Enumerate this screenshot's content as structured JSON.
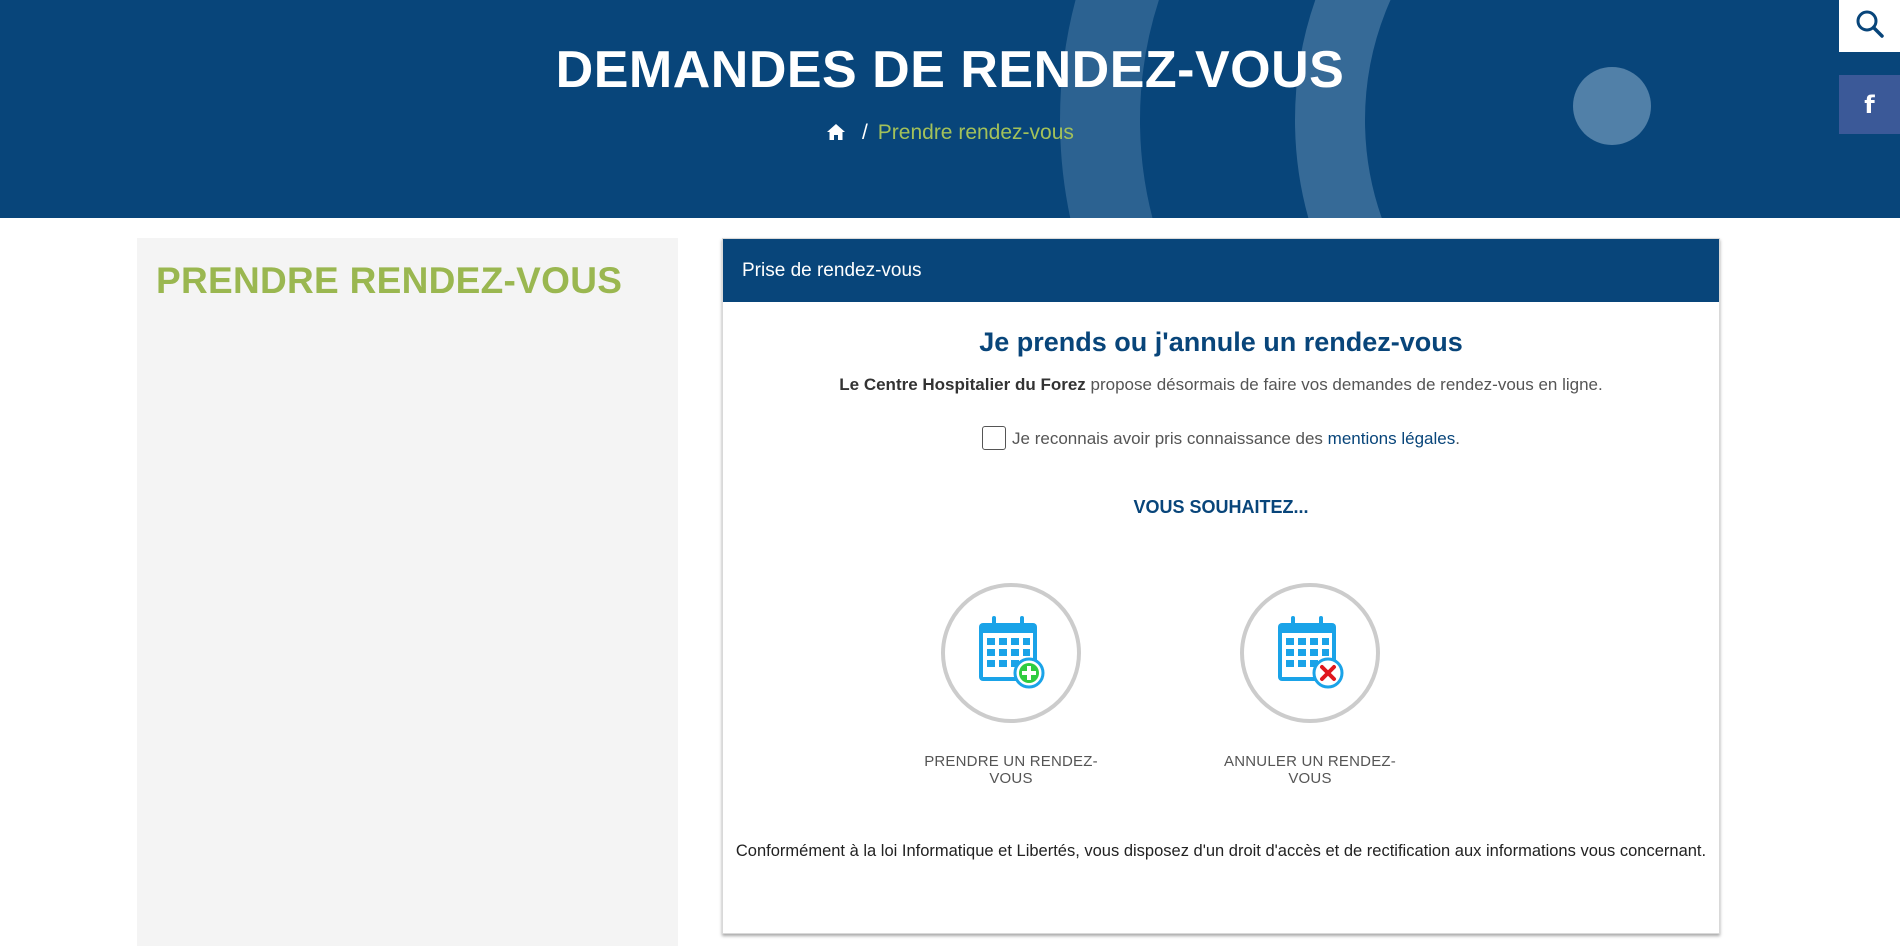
{
  "hero": {
    "title": "DEMANDES DE RENDEZ-VOUS",
    "breadcrumb": {
      "home_icon": "home-icon",
      "separator": "/",
      "current": "Prendre rendez-vous"
    }
  },
  "social": {
    "search_icon": "search-icon",
    "facebook_icon": "facebook-icon",
    "facebook_glyph": "f"
  },
  "sidebar": {
    "title": "PRENDRE RENDEZ-VOUS"
  },
  "card": {
    "header": "Prise de rendez-vous",
    "heading": "Je prends ou j'annule un rendez-vous",
    "intro_bold": "Le Centre Hospitalier du Forez",
    "intro_rest": " propose désormais de faire vos demandes de rendez-vous en ligne.",
    "consent_text": "Je reconnais avoir pris connaissance des ",
    "consent_link": "mentions légales",
    "consent_end": ".",
    "wish": "VOUS SOUHAITEZ...",
    "actions": [
      {
        "label": "PRENDRE UN RENDEZ-VOUS",
        "icon": "calendar-add-icon"
      },
      {
        "label": "ANNULER UN RENDEZ-VOUS",
        "icon": "calendar-cancel-icon"
      }
    ],
    "legal": "Conformément à la loi Informatique et Libertés, vous disposez d'un droit d'accès et de rectification aux informations vous concernant."
  },
  "colors": {
    "brand_blue": "#08457a",
    "accent_green": "#9ab750",
    "calendar_blue": "#1aa3e8",
    "add_green": "#2ecc40",
    "cancel_red": "#e0161d"
  }
}
